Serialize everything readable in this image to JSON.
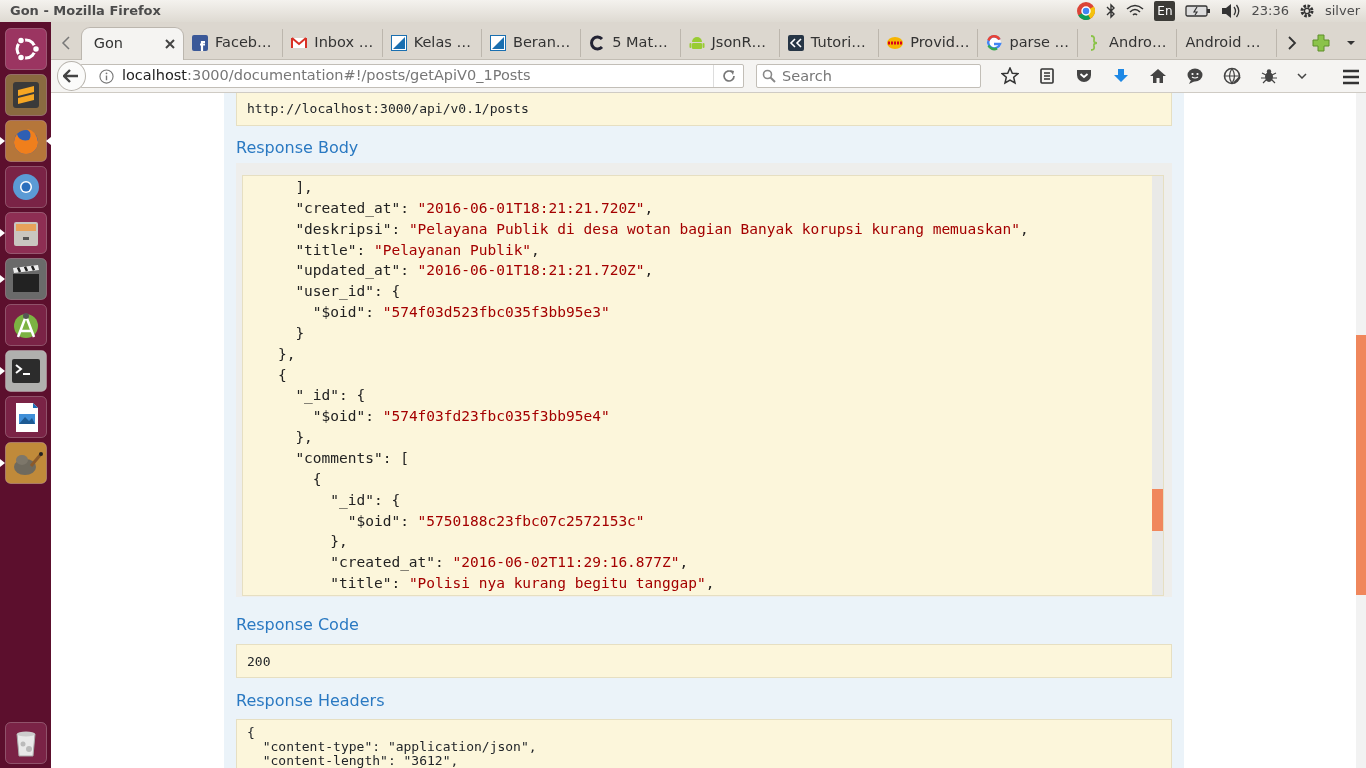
{
  "panel": {
    "title": "Gon - Mozilla Firefox",
    "keyboard": "En",
    "clock": "23:36",
    "user": "silver"
  },
  "launcher": [
    {
      "kind": "ubuntu",
      "running": false,
      "focused": false
    },
    {
      "kind": "sublime",
      "running": false,
      "focused": false
    },
    {
      "kind": "firefox",
      "running": true,
      "focused": true
    },
    {
      "kind": "chromium",
      "running": false,
      "focused": false
    },
    {
      "kind": "files",
      "running": true,
      "focused": false
    },
    {
      "kind": "video",
      "running": true,
      "focused": false
    },
    {
      "kind": "android",
      "running": false,
      "focused": false
    },
    {
      "kind": "terminal",
      "running": true,
      "focused": false
    },
    {
      "kind": "writer",
      "running": false,
      "focused": false
    },
    {
      "kind": "gimp",
      "running": true,
      "focused": false
    },
    {
      "kind": "trash",
      "running": false,
      "focused": false
    }
  ],
  "tabs": [
    {
      "label": "Gon",
      "kind": "none",
      "selected": true
    },
    {
      "label": "Faceb…",
      "kind": "f-square",
      "selected": false
    },
    {
      "label": "Inbox …",
      "kind": "envelope",
      "selected": false
    },
    {
      "label": "Kelas …",
      "kind": "diag-square",
      "selected": false
    },
    {
      "label": "Beran…",
      "kind": "diag-square",
      "selected": false
    },
    {
      "label": "5 Mat…",
      "kind": "c-ring",
      "selected": false
    },
    {
      "label": "JsonR…",
      "kind": "robot",
      "selected": false
    },
    {
      "label": "Tutori…",
      "kind": "chevrons",
      "selected": false
    },
    {
      "label": "Provid…",
      "kind": "dots",
      "selected": false
    },
    {
      "label": "parse …",
      "kind": "g-ring",
      "selected": false
    },
    {
      "label": "Andro…",
      "kind": "brace",
      "selected": false
    },
    {
      "label": "Android …",
      "kind": "none",
      "selected": false
    }
  ],
  "toolbar": {
    "url_host": "localhost",
    "url_path": ":3000/documentation#!/posts/getApiV0_1Posts",
    "search_placeholder": "Search"
  },
  "page": {
    "request_url": "http://localhost:3000/api/v0.1/posts",
    "body_heading": "Response Body",
    "body_lines": [
      {
        "code": "      ],"
      },
      {
        "code": "      \"created_at\": ",
        "value": "\"2016-06-01T18:21:21.720Z\"",
        "tail": ","
      },
      {
        "code": "      \"deskripsi\": ",
        "value": "\"Pelayana Publik di desa wotan bagian Banyak korupsi kurang memuaskan\"",
        "tail": ","
      },
      {
        "code": "      \"title\": ",
        "value": "\"Pelayanan Publik\"",
        "tail": ","
      },
      {
        "code": "      \"updated_at\": ",
        "value": "\"2016-06-01T18:21:21.720Z\"",
        "tail": ","
      },
      {
        "code": "      \"user_id\": {"
      },
      {
        "code": "        \"$oid\": ",
        "value": "\"574f03d523fbc035f3bb95e3\""
      },
      {
        "code": "      }"
      },
      {
        "code": "    },"
      },
      {
        "code": "    {"
      },
      {
        "code": "      \"_id\": {"
      },
      {
        "code": "        \"$oid\": ",
        "value": "\"574f03fd23fbc035f3bb95e4\""
      },
      {
        "code": "      },"
      },
      {
        "code": "      \"comments\": ["
      },
      {
        "code": "        {"
      },
      {
        "code": "          \"_id\": {"
      },
      {
        "code": "            \"$oid\": ",
        "value": "\"5750188c23fbc07c2572153c\""
      },
      {
        "code": "          },"
      },
      {
        "code": "          \"created_at\": ",
        "value": "\"2016-06-02T11:29:16.877Z\"",
        "tail": ","
      },
      {
        "code": "          \"title\": ",
        "value": "\"Polisi nya kurang begitu tanggap\"",
        "tail": ","
      }
    ],
    "code_heading": "Response Code",
    "code_value": "200",
    "headers_heading": "Response Headers",
    "header_lines": [
      "{",
      "  \"content-type\": \"application/json\",",
      "  \"content-length\": \"3612\","
    ]
  }
}
